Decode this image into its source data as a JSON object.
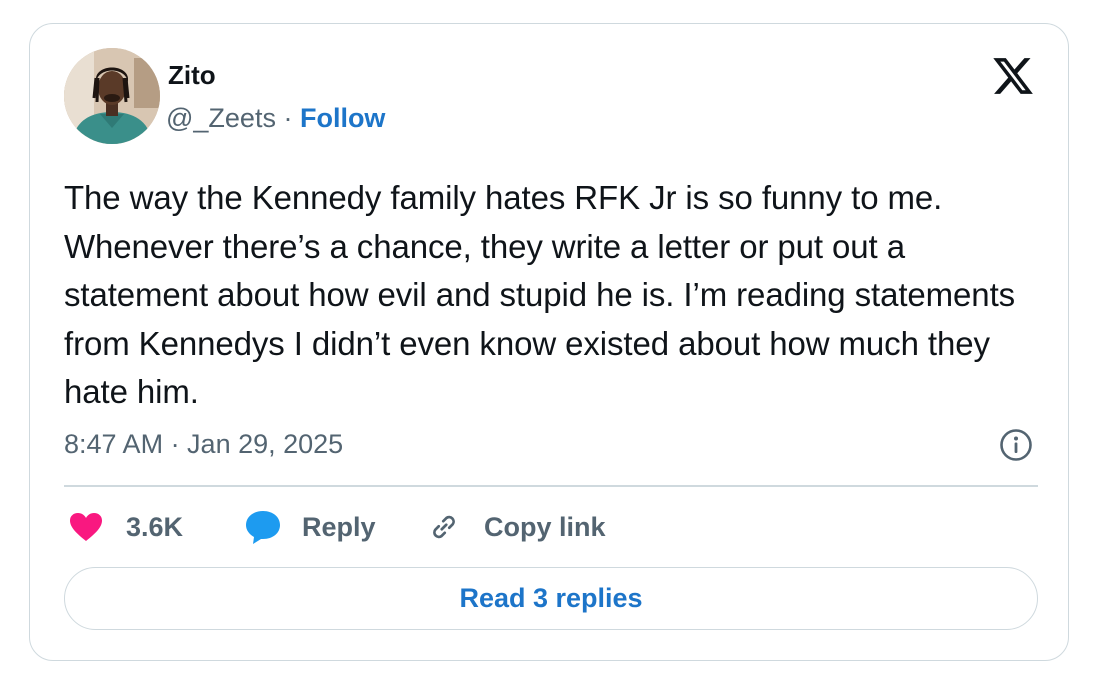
{
  "author": {
    "name": "Zito",
    "handle": "@_Zeets",
    "separator": " · ",
    "follow_label": "Follow"
  },
  "tweet": {
    "text": "The way the Kennedy family hates RFK Jr is so funny to me. Whenever there’s a chance, they write a letter or put out a statement about how evil and stupid he is. I’m reading statements from Kennedys I didn’t even know existed about how much they hate him.",
    "timestamp": "8:47 AM · Jan 29, 2025"
  },
  "actions": {
    "like_count": "3.6K",
    "reply_label": "Reply",
    "copy_link_label": "Copy link"
  },
  "read_replies_label": "Read 3 replies",
  "icons": {
    "logo": "x-logo-icon",
    "info": "info-icon",
    "like": "heart-icon",
    "reply": "speech-bubble-icon",
    "copy": "link-icon"
  },
  "colors": {
    "link_blue": "#1d75c9",
    "heart_pink": "#f91880",
    "reply_blue": "#1d9bf0",
    "text_primary": "#0f1419",
    "text_secondary": "#536471",
    "border": "#cfd9de"
  }
}
